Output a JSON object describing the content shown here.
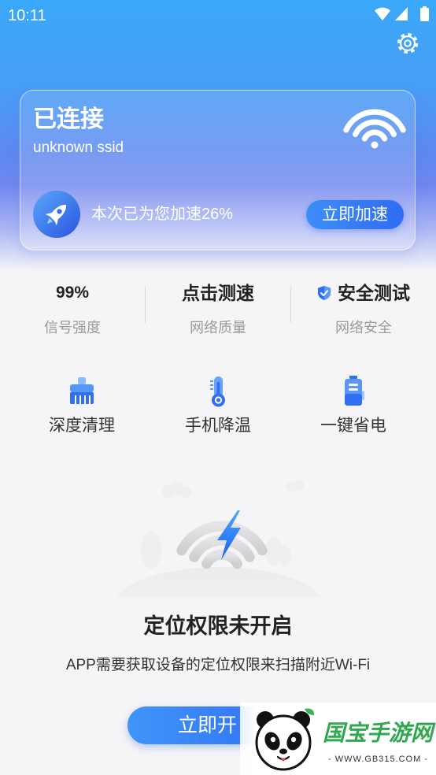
{
  "status_bar": {
    "time": "10:11",
    "icons": [
      "wifi-icon",
      "signal-icon",
      "battery-icon"
    ]
  },
  "header": {
    "settings_icon": "gear-icon"
  },
  "connection_card": {
    "status": "已连接",
    "ssid": "unknown ssid",
    "wifi_icon": "wifi-icon",
    "boost": {
      "icon": "rocket-icon",
      "text": "本次已为您加速26%",
      "button": "立即加速"
    }
  },
  "stats": [
    {
      "value": "99%",
      "label": "信号强度"
    },
    {
      "value": "点击测速",
      "label": "网络质量"
    },
    {
      "value": "安全测试",
      "label": "网络安全",
      "icon": "shield-icon"
    }
  ],
  "tools": [
    {
      "label": "深度清理",
      "icon": "brush-clean-icon"
    },
    {
      "label": "手机降温",
      "icon": "thermometer-icon"
    },
    {
      "label": "一键省电",
      "icon": "battery-saver-icon"
    }
  ],
  "permission": {
    "illustration": "wifi-lightning-illustration",
    "title": "定位权限未开启",
    "description": "APP需要获取设备的定位权限来扫描附近Wi-Fi",
    "button": "立即开"
  },
  "watermark": {
    "logo": "panda-logo",
    "name": "国宝手游网",
    "url": "- WWW.GB315.COM -"
  },
  "colors": {
    "header_top": "#3aa8f8",
    "header_mid": "#6a85f0",
    "accent": "#2f6ff0",
    "page_background": "#f5f5f7",
    "text_primary": "#222222",
    "text_secondary": "#999999",
    "watermark_green": "#2fa84f"
  }
}
